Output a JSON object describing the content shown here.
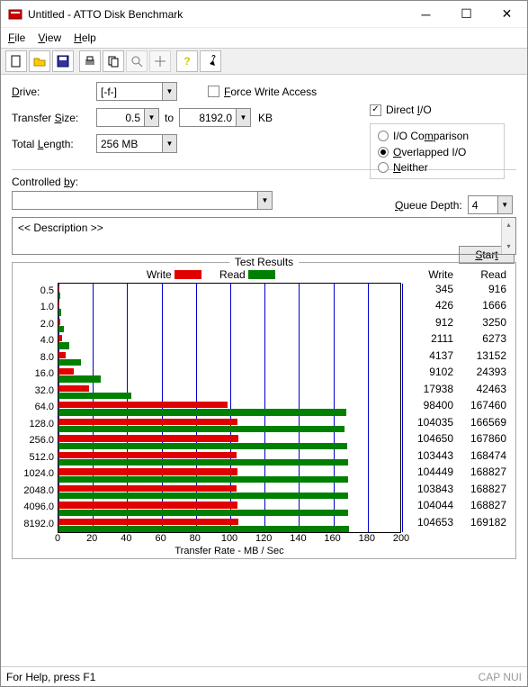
{
  "window": {
    "title": "Untitled - ATTO Disk Benchmark"
  },
  "menu": {
    "file": "File",
    "view": "View",
    "help": "Help"
  },
  "form": {
    "drive_label": "Drive:",
    "drive_value": "[-f-]",
    "transfer_size_label": "Transfer Size:",
    "ts_from": "0.5",
    "ts_to_label": "to",
    "ts_to": "8192.0",
    "ts_unit": "KB",
    "total_length_label": "Total Length:",
    "total_length_value": "256 MB",
    "force_write": "Force Write Access",
    "direct_io": "Direct I/O",
    "io_comparison": "I/O Comparison",
    "overlapped_io": "Overlapped I/O",
    "neither": "Neither",
    "queue_depth_label": "Queue Depth:",
    "queue_depth_value": "4",
    "controlled_by": "Controlled by:",
    "start": "Start",
    "description": "<< Description >>"
  },
  "results": {
    "title": "Test Results",
    "write_label": "Write",
    "read_label": "Read",
    "xlabel": "Transfer Rate - MB / Sec"
  },
  "chart_data": {
    "type": "bar",
    "orientation": "horizontal",
    "xlabel": "Transfer Rate - MB / Sec",
    "xlim": [
      0,
      200
    ],
    "xticks": [
      0,
      20,
      40,
      60,
      80,
      100,
      120,
      140,
      160,
      180,
      200
    ],
    "categories": [
      "0.5",
      "1.0",
      "2.0",
      "4.0",
      "8.0",
      "16.0",
      "32.0",
      "64.0",
      "128.0",
      "256.0",
      "512.0",
      "1024.0",
      "2048.0",
      "4096.0",
      "8192.0"
    ],
    "series": [
      {
        "name": "Write",
        "color": "#e00000",
        "values_kb": [
          345,
          426,
          912,
          2111,
          4137,
          9102,
          17938,
          98400,
          104035,
          104650,
          103443,
          104449,
          103843,
          104044,
          104653
        ]
      },
      {
        "name": "Read",
        "color": "#008000",
        "values_kb": [
          916,
          1666,
          3250,
          6273,
          13152,
          24393,
          42463,
          167460,
          166569,
          167860,
          168474,
          168827,
          168827,
          168827,
          169182
        ]
      }
    ]
  },
  "status": {
    "left": "For Help, press F1",
    "right": "CAP NUI"
  }
}
